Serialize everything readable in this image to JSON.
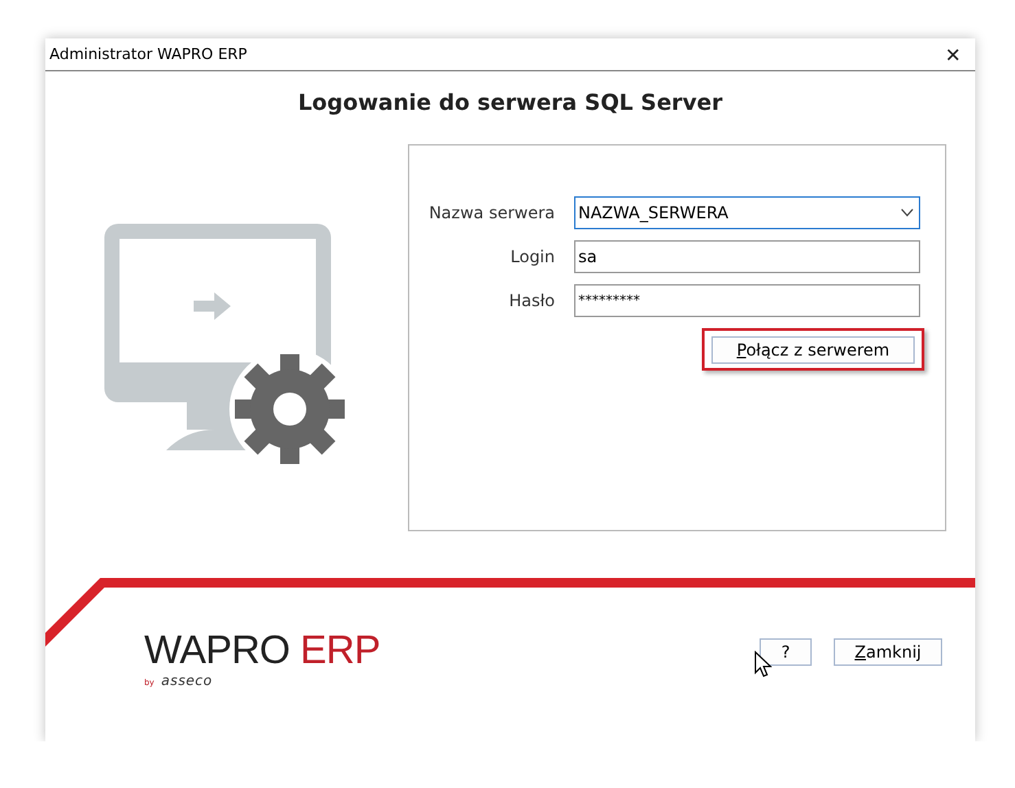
{
  "window": {
    "title": "Administrator WAPRO ERP",
    "close_glyph": "✕"
  },
  "heading": "Logowanie do serwera SQL Server",
  "form": {
    "fields": [
      {
        "kind": "combo",
        "label": "Nazwa serwera",
        "value": "NAZWA_SERWERA",
        "focused": true
      },
      {
        "kind": "text",
        "label": "Login",
        "value": "sa",
        "focused": false
      },
      {
        "kind": "password",
        "label": "Hasło",
        "value": "*********",
        "focused": false
      }
    ],
    "connect_button": {
      "label": "Połącz z serwerem",
      "highlighted": true
    }
  },
  "logo": {
    "name": "WAPRO",
    "suffix": "ERP",
    "by": "by",
    "brand": "asseco"
  },
  "buttons": [
    {
      "label": "?"
    },
    {
      "label": "Zamknij"
    }
  ]
}
